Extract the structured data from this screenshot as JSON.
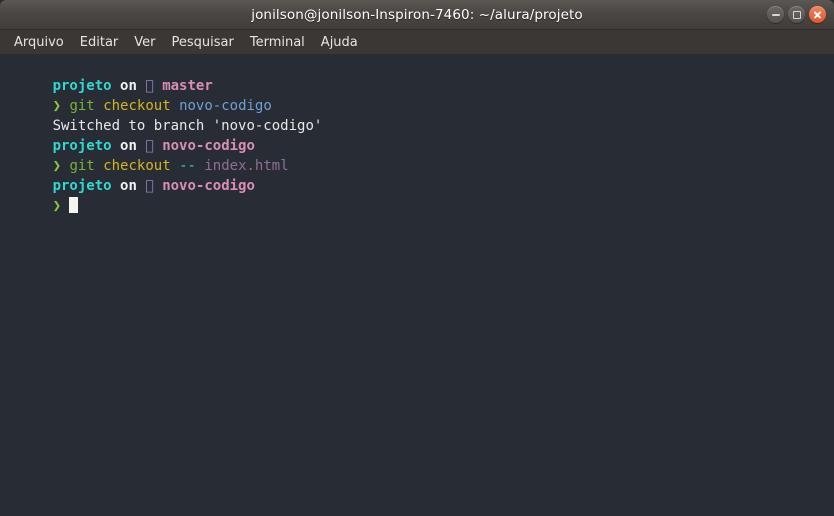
{
  "window": {
    "title": "jonilson@jonilson-Inspiron-7460: ~/alura/projeto",
    "controls": {
      "minimize_label": "Minimizar",
      "maximize_label": "Maximizar",
      "close_label": "Fechar"
    }
  },
  "menubar": {
    "items": [
      {
        "label": "Arquivo"
      },
      {
        "label": "Editar"
      },
      {
        "label": "Ver"
      },
      {
        "label": "Pesquisar"
      },
      {
        "label": "Terminal"
      },
      {
        "label": "Ajuda"
      }
    ]
  },
  "terminal": {
    "background": "#282c34",
    "colors": {
      "dir": "#2fd9d0",
      "on": "#f2f2f2",
      "branch_glyph": "#9a7ec8",
      "branch_name": "#d98fb4",
      "prompt_arrow": "#8ece3c",
      "command": "#78b33a",
      "subcommand": "#d6b422",
      "argument": "#6e9fd6",
      "flag": "#2fd9d0",
      "filename": "#8d6f96",
      "output": "#e8e8e8",
      "cursor": "#f5f5f0"
    },
    "lines": [
      {
        "kind": "prompt-context",
        "dir": "projeto",
        "on": "on",
        "branch_glyph": "",
        "branch": "master"
      },
      {
        "kind": "command",
        "arrow": "❯",
        "command": "git",
        "subcommand": "checkout",
        "argument": "novo-codigo"
      },
      {
        "kind": "output",
        "text": "Switched to branch 'novo-codigo'"
      },
      {
        "kind": "prompt-context",
        "dir": "projeto",
        "on": "on",
        "branch_glyph": "",
        "branch": "novo-codigo"
      },
      {
        "kind": "command-file",
        "arrow": "❯",
        "command": "git",
        "subcommand": "checkout",
        "flag": "--",
        "filename": "index.html"
      },
      {
        "kind": "prompt-context",
        "dir": "projeto",
        "on": "on",
        "branch_glyph": "",
        "branch": "novo-codigo"
      },
      {
        "kind": "cursor-line",
        "arrow": "❯"
      }
    ]
  },
  "space": {
    "s": " "
  }
}
